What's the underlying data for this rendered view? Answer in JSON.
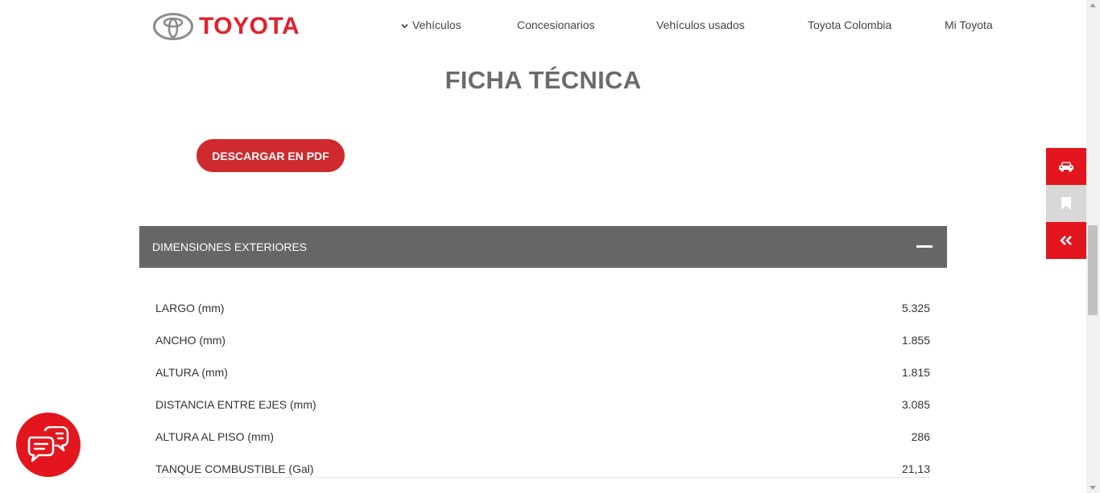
{
  "brand": {
    "name": "TOYOTA",
    "color": "#e2202c"
  },
  "nav": {
    "vehicles": "Vehículos",
    "dealers": "Concesionarios",
    "used": "Vehículos usados",
    "colombia": "Toyota Colombia",
    "mine": "Mi Toyota"
  },
  "page": {
    "title": "FICHA TÉCNICA",
    "pdf_button": "DESCARGAR EN PDF"
  },
  "section": {
    "title": "DIMENSIONES EXTERIORES",
    "rows": [
      {
        "label": "LARGO (mm)",
        "value": "5.325"
      },
      {
        "label": "ANCHO (mm)",
        "value": "1.855"
      },
      {
        "label": "ALTURA (mm)",
        "value": "1.815"
      },
      {
        "label": "DISTANCIA ENTRE EJES (mm)",
        "value": "3.085"
      },
      {
        "label": "ALTURA AL PISO (mm)",
        "value": "286"
      },
      {
        "label": "TANQUE COMBUSTIBLE (Gal)",
        "value": "21,13"
      }
    ]
  },
  "side_widgets": [
    {
      "icon": "car-icon"
    },
    {
      "icon": "bookmark-icon"
    },
    {
      "icon": "double-chevron-left-icon"
    }
  ],
  "chat": {
    "icon": "chat-bubbles-icon"
  },
  "colors": {
    "accent": "#e3151d",
    "button": "#cf2a2d",
    "section_header": "#666666"
  }
}
